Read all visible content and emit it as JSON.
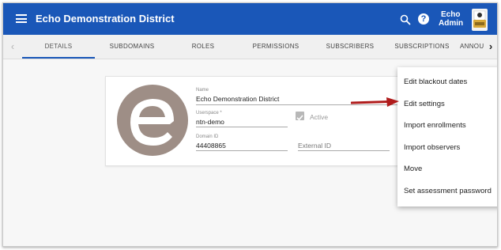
{
  "app": {
    "title": "Echo Demonstration District",
    "user_line1": "Echo",
    "user_line2": "Admin"
  },
  "tabs": [
    {
      "label": "DETAILS",
      "active": true
    },
    {
      "label": "SUBDOMAINS"
    },
    {
      "label": "ROLES"
    },
    {
      "label": "PERMISSIONS"
    },
    {
      "label": "SUBSCRIBERS"
    },
    {
      "label": "SUBSCRIPTIONS"
    },
    {
      "label": "ANNOU"
    }
  ],
  "details": {
    "name_label": "Name",
    "name_value": "Echo Demonstration District",
    "userspace_label": "Userspace *",
    "userspace_value": "ntn-demo",
    "active_label": "Active",
    "active_checked": true,
    "domain_id_label": "Domain ID",
    "domain_id_value": "44408865",
    "external_id_placeholder": "External ID"
  },
  "menu": {
    "items": [
      "Edit blackout dates",
      "Edit settings",
      "Import enrollments",
      "Import observers",
      "Move",
      "Set assessment password"
    ]
  },
  "colors": {
    "app_bar": "#1a57b8",
    "logo_circle": "#9e8e86",
    "callout_arrow": "#b01c1c"
  },
  "icons": {
    "menu": "hamburger-icon",
    "search": "search-icon",
    "help": "help-icon",
    "chevron_left": "chevron-left-icon",
    "chevron_right": "chevron-right-icon",
    "check": "check-icon"
  }
}
